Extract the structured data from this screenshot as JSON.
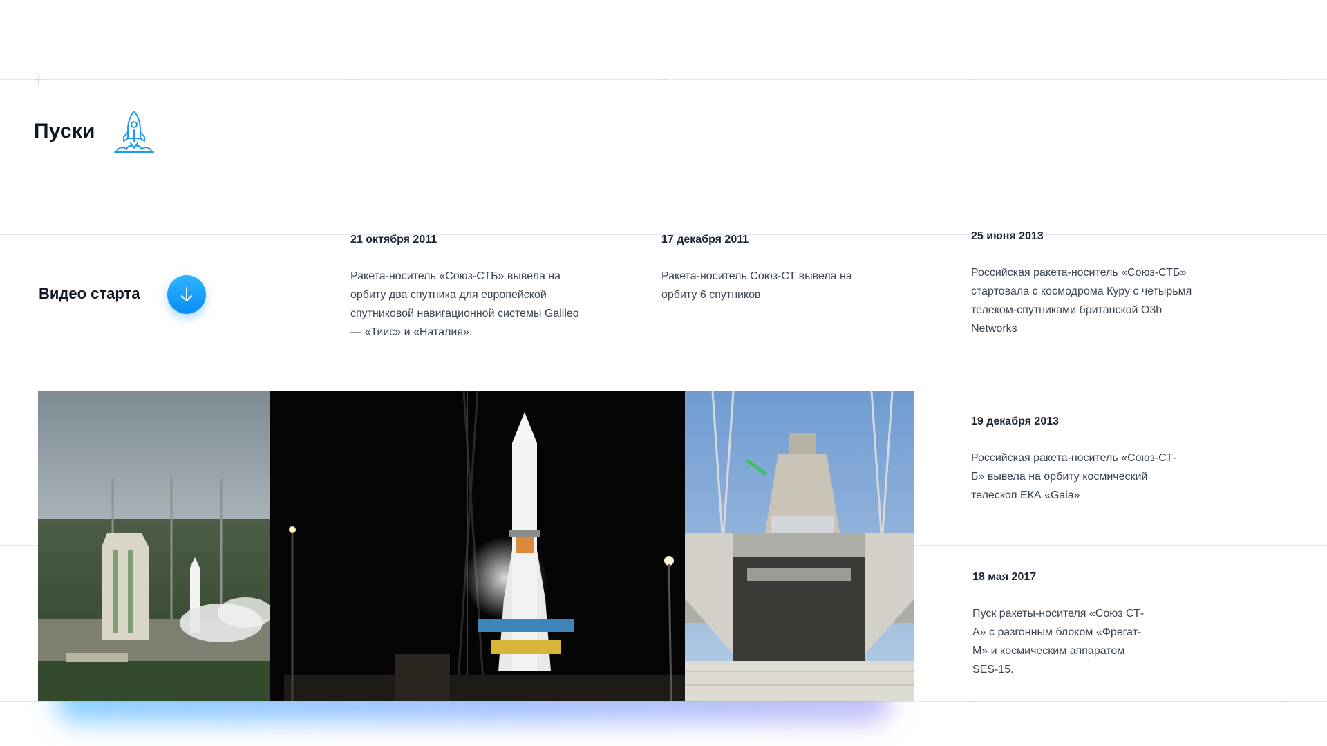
{
  "section": {
    "title": "Пуски",
    "icon": "rocket-launch-icon"
  },
  "video": {
    "label": "Видео старта",
    "button_icon": "arrow-down-icon"
  },
  "events": [
    {
      "date": "21 октября 2011",
      "text": "Ракета-носитель «Союз-СТБ» вывела на орбиту два спутника для европейской спутниковой навигационной системы Galileo — «Тиис» и «Наталия»."
    },
    {
      "date": "17 декабря 2011",
      "text": "Ракета-носитель Союз-СТ вывела на орбиту 6 спутников"
    },
    {
      "date": "25 июня 2013",
      "text": "Российская ракета-носитель «Союз-СТБ» стартовала с космодрома Куру с четырьмя телеком-спутниками британской O3b Networks"
    },
    {
      "date": "19 декабря 2013",
      "text": "Российская ракета-носитель «Союз-СТ-Б» вывела на орбиту космический телескоп ЕКА «Gaia»"
    },
    {
      "date": "18 мая 2017",
      "text": "Пуск ракеты-носителя «Союз СТ-А» с разгонным блоком «Фрегат-М» и космическим аппаратом SES-15."
    }
  ],
  "colors": {
    "accent": "#0a8ef5",
    "grid_line": "#e6e8eb",
    "text_primary": "#0f1720",
    "text_secondary": "#3a4452"
  }
}
